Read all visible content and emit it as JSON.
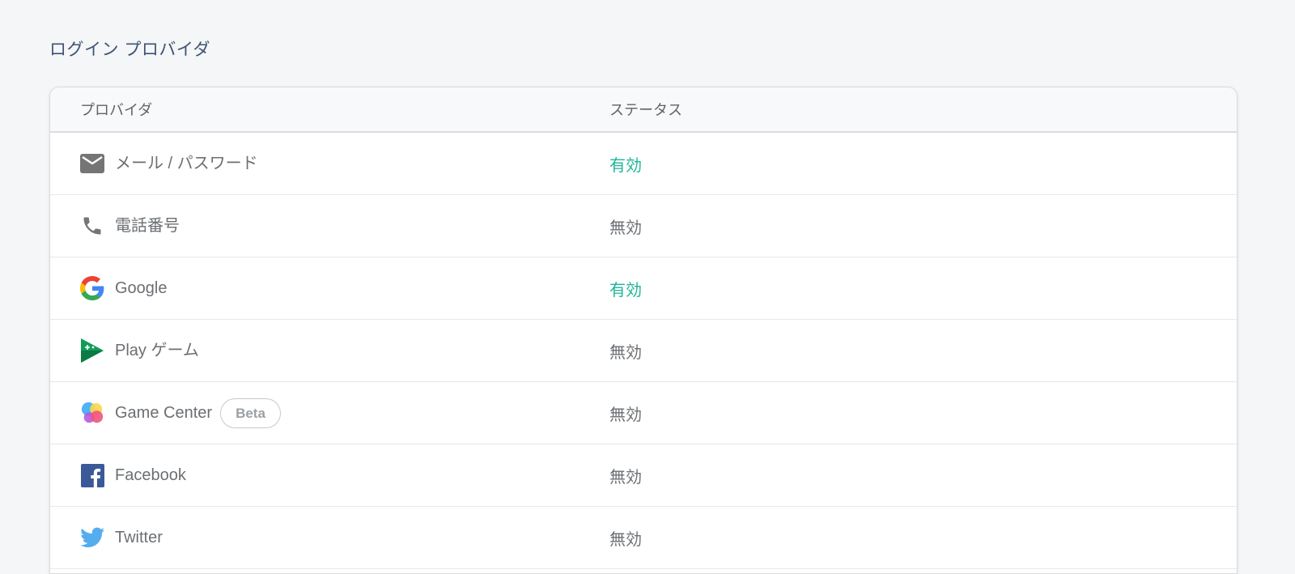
{
  "section_title": "ログイン プロバイダ",
  "table": {
    "headers": {
      "provider": "プロバイダ",
      "status": "ステータス"
    },
    "rows": [
      {
        "provider": "メール / パスワード",
        "icon": "mail-icon",
        "status": "有効",
        "status_state": "enabled"
      },
      {
        "provider": "電話番号",
        "icon": "phone-icon",
        "status": "無効",
        "status_state": "disabled"
      },
      {
        "provider": "Google",
        "icon": "google-icon",
        "status": "有効",
        "status_state": "enabled"
      },
      {
        "provider": "Play ゲーム",
        "icon": "play-games-icon",
        "status": "無効",
        "status_state": "disabled"
      },
      {
        "provider": "Game Center",
        "icon": "game-center-icon",
        "badge": "Beta",
        "status": "無効",
        "status_state": "disabled"
      },
      {
        "provider": "Facebook",
        "icon": "facebook-icon",
        "status": "無効",
        "status_state": "disabled"
      },
      {
        "provider": "Twitter",
        "icon": "twitter-icon",
        "status": "無効",
        "status_state": "disabled"
      }
    ]
  },
  "colors": {
    "enabled": "#1fb498",
    "disabled": "#6b6f73",
    "title": "#3c5470",
    "background": "#f5f6f8"
  }
}
